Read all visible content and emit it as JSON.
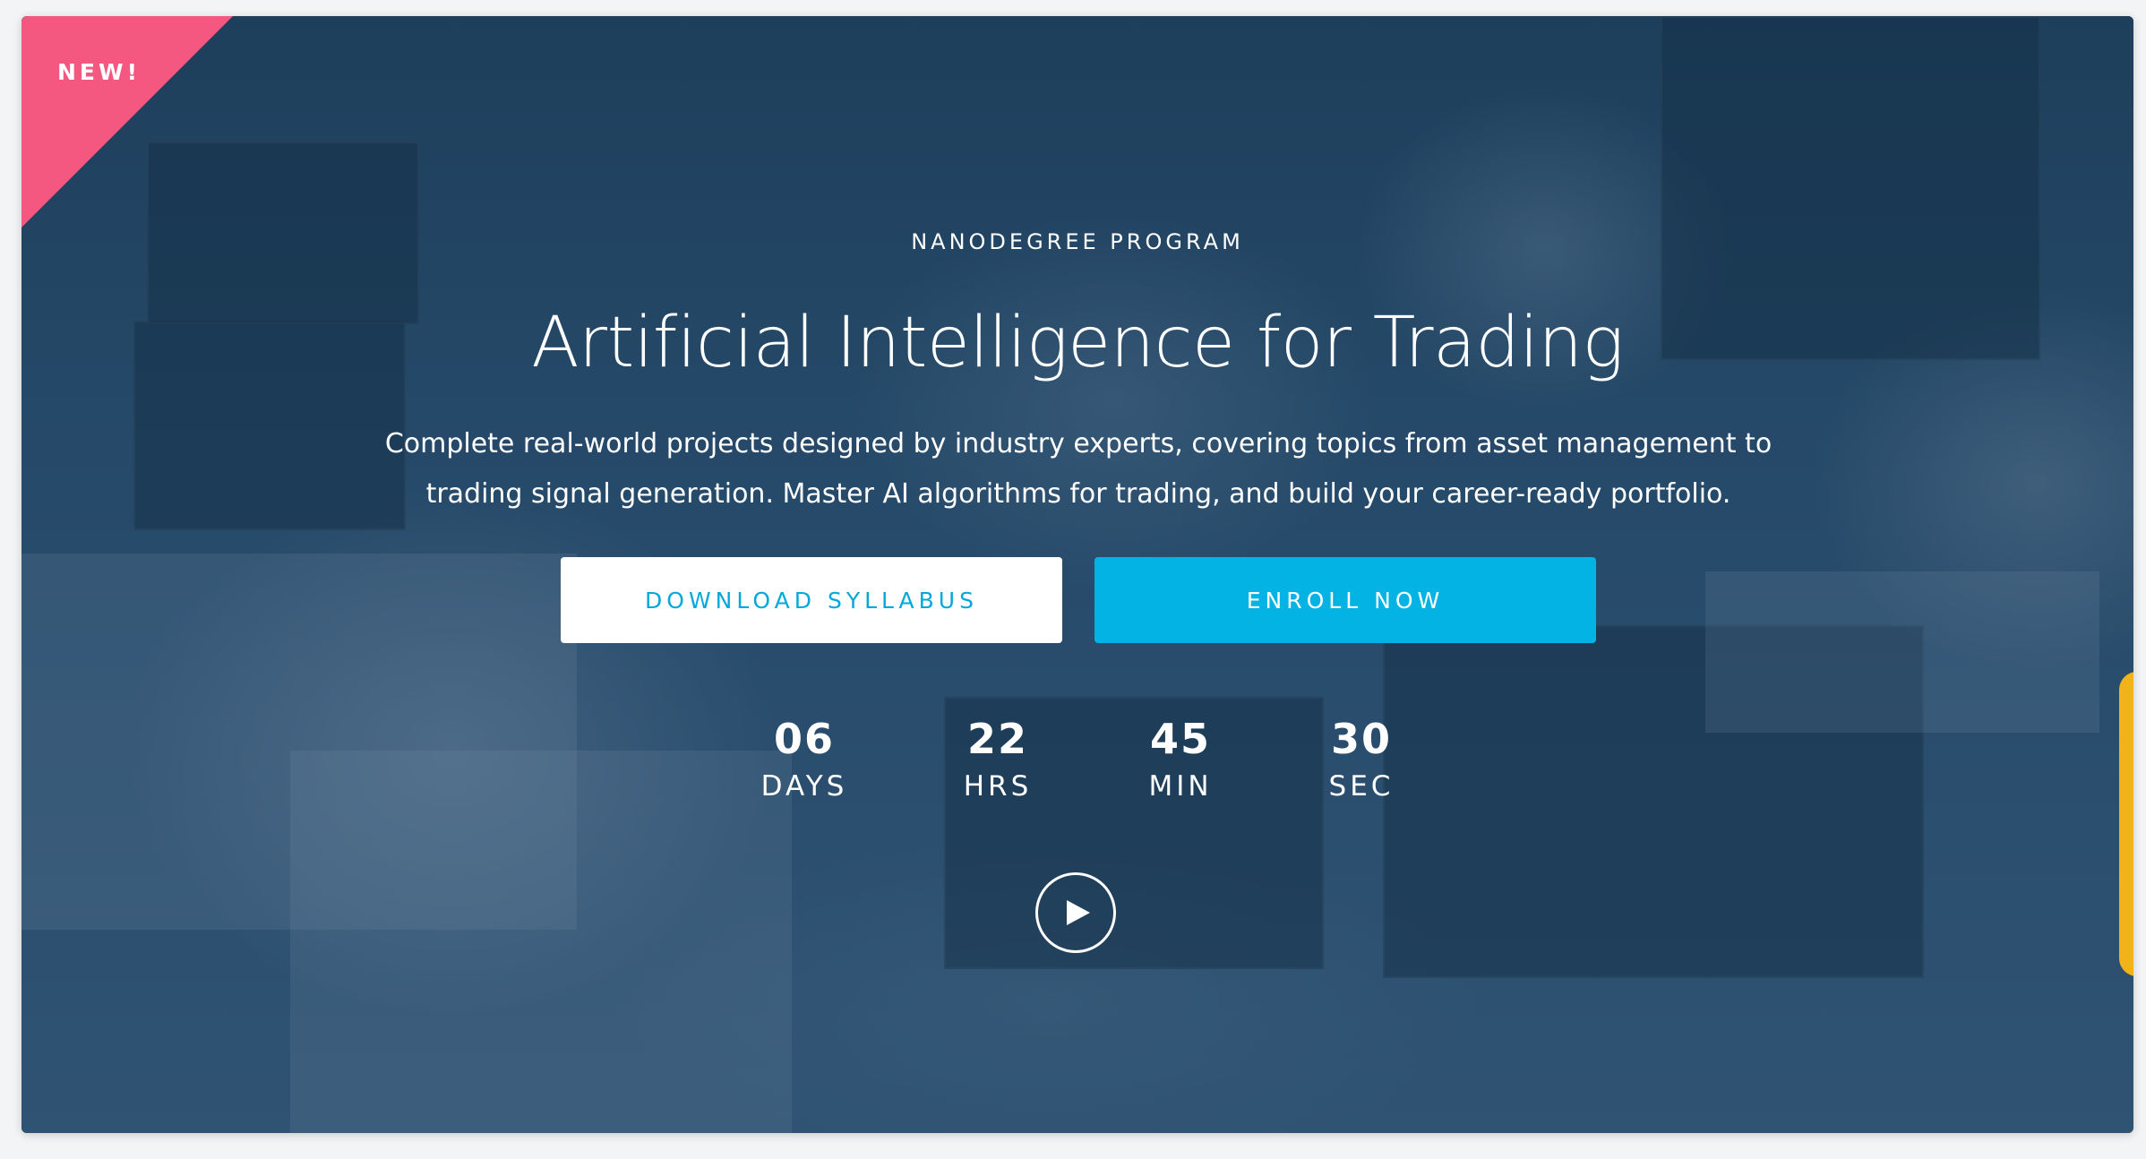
{
  "hero": {
    "badge": "NEW!",
    "eyebrow": "NANODEGREE PROGRAM",
    "title": "Artificial Intelligence for Trading",
    "description_line1": "Complete real-world projects designed by industry experts, covering topics from asset management to",
    "description_line2": "trading signal generation. Master AI algorithms for trading, and build your career-ready portfolio.",
    "buttons": {
      "syllabus_label": "DOWNLOAD SYLLABUS",
      "enroll_label": "ENROLL NOW"
    },
    "countdown": {
      "days": {
        "value": "06",
        "label": "DAYS"
      },
      "hours": {
        "value": "22",
        "label": "HRS"
      },
      "minutes": {
        "value": "45",
        "label": "MIN"
      },
      "seconds": {
        "value": "30",
        "label": "SEC"
      }
    },
    "play_icon": "play-icon"
  },
  "colors": {
    "badge": "#f4577f",
    "primary": "#02b3e4",
    "syllabus_text": "#02a8d9",
    "side_tab": "#f2b31a"
  }
}
